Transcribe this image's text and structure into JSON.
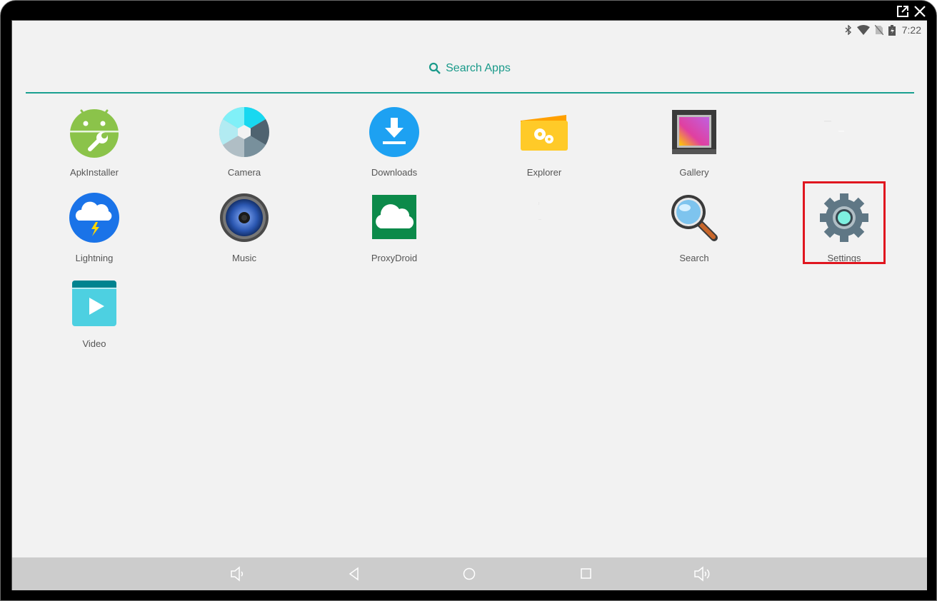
{
  "window": {
    "controls": [
      {
        "name": "popout",
        "icon": "external-window-icon"
      },
      {
        "name": "close",
        "icon": "close-icon"
      }
    ]
  },
  "status_bar": {
    "icons": [
      "bluetooth-icon",
      "wifi-icon",
      "no-sim-icon",
      "battery-charging-icon"
    ],
    "time": "7:22"
  },
  "search": {
    "icon": "search-icon",
    "label": "Search Apps",
    "accent_color": "#1a9a8a"
  },
  "apps": [
    {
      "label": "ApkInstaller",
      "icon": "android-wrench-icon"
    },
    {
      "label": "Camera",
      "icon": "camera-shutter-icon"
    },
    {
      "label": "Downloads",
      "icon": "download-icon"
    },
    {
      "label": "Explorer",
      "icon": "folder-gears-icon"
    },
    {
      "label": "Gallery",
      "icon": "picture-frame-icon"
    },
    {
      "label": "",
      "icon": "blank-app-icon"
    },
    {
      "label": "Lightning",
      "icon": "cloud-lightning-icon"
    },
    {
      "label": "Music",
      "icon": "speaker-icon"
    },
    {
      "label": "ProxyDroid",
      "icon": "cloud-icon"
    },
    {
      "label": "",
      "icon": "blank-app-icon"
    },
    {
      "label": "Search",
      "icon": "magnifier-icon"
    },
    {
      "label": "Settings",
      "icon": "gear-icon",
      "highlighted": true,
      "highlight_color": "#e0161f"
    },
    {
      "label": "Video",
      "icon": "play-video-icon"
    }
  ],
  "nav_bar": {
    "buttons": [
      {
        "name": "volume-down",
        "icon": "volume-down-icon"
      },
      {
        "name": "back",
        "icon": "back-icon"
      },
      {
        "name": "home",
        "icon": "home-icon"
      },
      {
        "name": "recents",
        "icon": "recents-icon"
      },
      {
        "name": "volume-up",
        "icon": "volume-up-icon"
      }
    ]
  }
}
